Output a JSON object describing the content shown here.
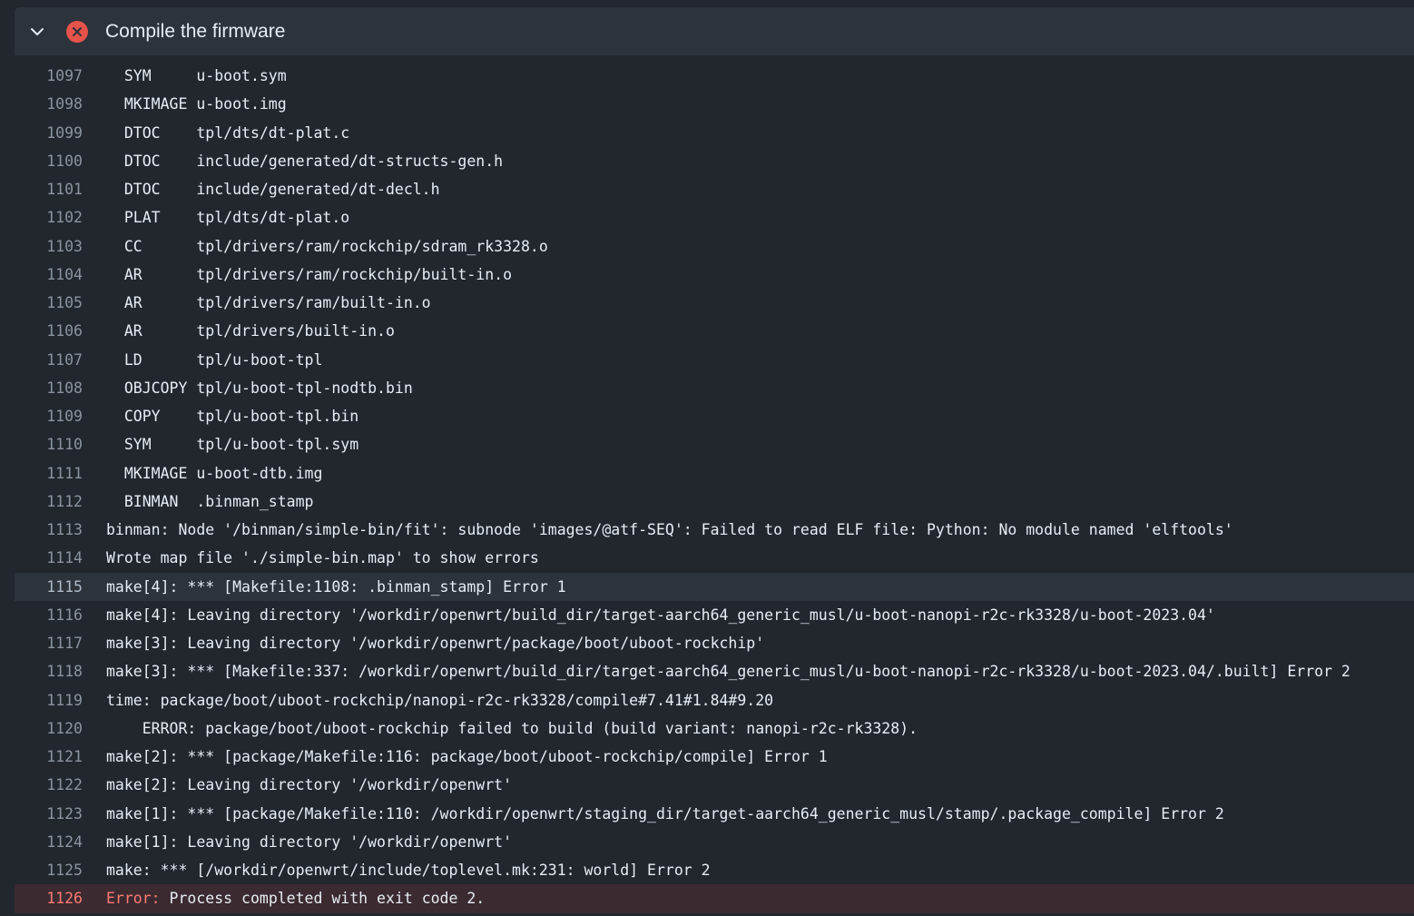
{
  "step": {
    "title": "Compile the firmware",
    "status": "failed",
    "icons": {
      "toggle": "chevron-down-icon",
      "status": "x-circle-icon"
    },
    "colors": {
      "failure": "#e5534b",
      "error_text": "#ff7b72"
    }
  },
  "log": {
    "lines": [
      {
        "n": "1097",
        "text": "  SYM     u-boot.sym"
      },
      {
        "n": "1098",
        "text": "  MKIMAGE u-boot.img"
      },
      {
        "n": "1099",
        "text": "  DTOC    tpl/dts/dt-plat.c"
      },
      {
        "n": "1100",
        "text": "  DTOC    include/generated/dt-structs-gen.h"
      },
      {
        "n": "1101",
        "text": "  DTOC    include/generated/dt-decl.h"
      },
      {
        "n": "1102",
        "text": "  PLAT    tpl/dts/dt-plat.o"
      },
      {
        "n": "1103",
        "text": "  CC      tpl/drivers/ram/rockchip/sdram_rk3328.o"
      },
      {
        "n": "1104",
        "text": "  AR      tpl/drivers/ram/rockchip/built-in.o"
      },
      {
        "n": "1105",
        "text": "  AR      tpl/drivers/ram/built-in.o"
      },
      {
        "n": "1106",
        "text": "  AR      tpl/drivers/built-in.o"
      },
      {
        "n": "1107",
        "text": "  LD      tpl/u-boot-tpl"
      },
      {
        "n": "1108",
        "text": "  OBJCOPY tpl/u-boot-tpl-nodtb.bin"
      },
      {
        "n": "1109",
        "text": "  COPY    tpl/u-boot-tpl.bin"
      },
      {
        "n": "1110",
        "text": "  SYM     tpl/u-boot-tpl.sym"
      },
      {
        "n": "1111",
        "text": "  MKIMAGE u-boot-dtb.img"
      },
      {
        "n": "1112",
        "text": "  BINMAN  .binman_stamp"
      },
      {
        "n": "1113",
        "text": "binman: Node '/binman/simple-bin/fit': subnode 'images/@atf-SEQ': Failed to read ELF file: Python: No module named 'elftools'"
      },
      {
        "n": "1114",
        "text": "Wrote map file './simple-bin.map' to show errors"
      },
      {
        "n": "1115",
        "text": "make[4]: *** [Makefile:1108: .binman_stamp] Error 1"
      },
      {
        "n": "1116",
        "text": "make[4]: Leaving directory '/workdir/openwrt/build_dir/target-aarch64_generic_musl/u-boot-nanopi-r2c-rk3328/u-boot-2023.04'"
      },
      {
        "n": "1117",
        "text": "make[3]: Leaving directory '/workdir/openwrt/package/boot/uboot-rockchip'"
      },
      {
        "n": "1118",
        "text": "make[3]: *** [Makefile:337: /workdir/openwrt/build_dir/target-aarch64_generic_musl/u-boot-nanopi-r2c-rk3328/u-boot-2023.04/.built] Error 2"
      },
      {
        "n": "1119",
        "text": "time: package/boot/uboot-rockchip/nanopi-r2c-rk3328/compile#7.41#1.84#9.20"
      },
      {
        "n": "1120",
        "text": "    ERROR: package/boot/uboot-rockchip failed to build (build variant: nanopi-r2c-rk3328)."
      },
      {
        "n": "1121",
        "text": "make[2]: *** [package/Makefile:116: package/boot/uboot-rockchip/compile] Error 1"
      },
      {
        "n": "1122",
        "text": "make[2]: Leaving directory '/workdir/openwrt'"
      },
      {
        "n": "1123",
        "text": "make[1]: *** [package/Makefile:110: /workdir/openwrt/staging_dir/target-aarch64_generic_musl/stamp/.package_compile] Error 2"
      },
      {
        "n": "1124",
        "text": "make[1]: Leaving directory '/workdir/openwrt'"
      },
      {
        "n": "1125",
        "text": "make: *** [/workdir/openwrt/include/toplevel.mk:231: world] Error 2"
      }
    ],
    "final": {
      "n": "1126",
      "prefix": "Error:",
      "text": " Process completed with exit code 2."
    }
  }
}
